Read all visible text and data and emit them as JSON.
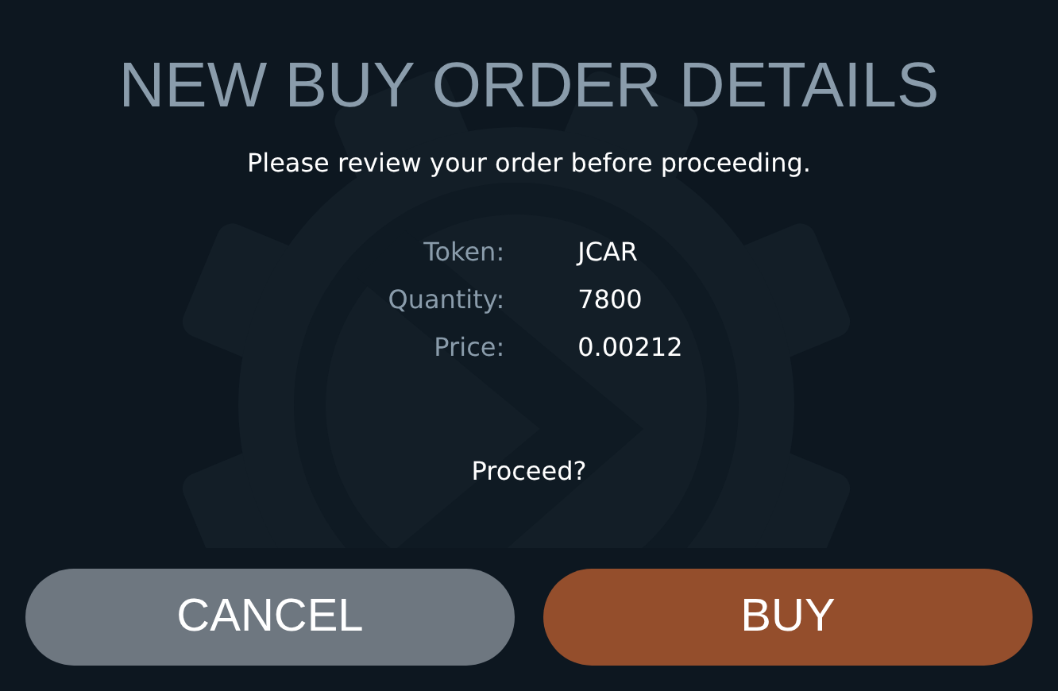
{
  "title": "NEW BUY ORDER DETAILS",
  "subtitle": "Please review your order before proceeding.",
  "details": [
    {
      "label": "Token:",
      "value": "JCAR"
    },
    {
      "label": "Quantity:",
      "value": "7800"
    },
    {
      "label": "Price:",
      "value": "0.00212"
    }
  ],
  "prompt": "Proceed?",
  "buttons": [
    {
      "label": "CANCEL",
      "kind": "cancel"
    },
    {
      "label": "BUY",
      "kind": "confirm"
    }
  ]
}
